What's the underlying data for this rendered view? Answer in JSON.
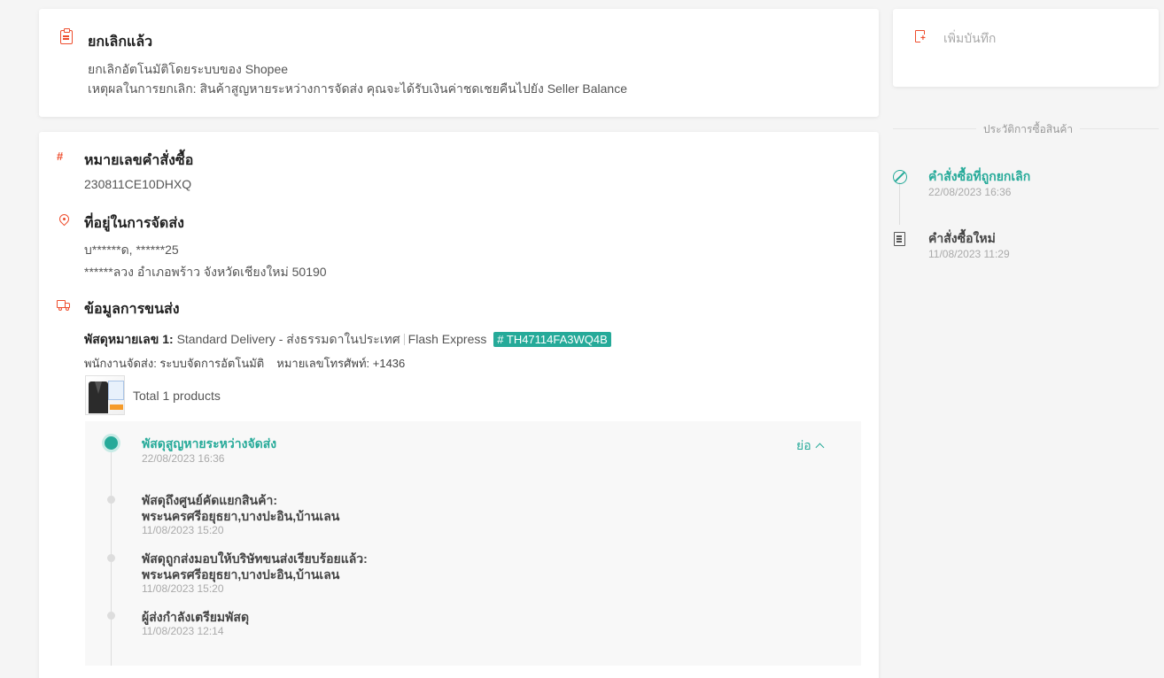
{
  "status": {
    "title": "ยกเลิกแล้ว",
    "line1": "ยกเลิกอัตโนมัติโดยระบบของ Shopee",
    "line2": "เหตุผลในการยกเลิก: สินค้าสูญหายระหว่างการจัดส่ง คุณจะได้รับเงินค่าชดเชยคืนไปยัง Seller Balance"
  },
  "order": {
    "number_title": "หมายเลขคำสั่งซื้อ",
    "number_icon": "#",
    "number": "230811CE10DHXQ",
    "address_title": "ที่อยู่ในการจัดส่ง",
    "address_line1": "บ******ด, ******25",
    "address_line2": "******ลวง อำเภอพร้าว จังหวัดเชียงใหม่ 50190",
    "shipping_title": "ข้อมูลการขนส่ง",
    "parcel_label": "พัสดุหมายเลข 1:",
    "parcel_service": "Standard Delivery - ส่งธรรมดาในประเทศ",
    "parcel_courier": "Flash Express",
    "tracking_number": "# TH47114FA3WQ4B",
    "courier_staff": "พนักงานจัดส่ง:  ระบบจัดการอัตโนมัติ",
    "courier_phone": "หมายเลขโทรศัพท์: +1436",
    "total_products": "Total 1 products"
  },
  "tracking": {
    "collapse_label": "ย่อ",
    "events": [
      {
        "title": "พัสดุสูญหายระหว่างจัดส่ง",
        "time": "22/08/2023 16:36"
      },
      {
        "title": "พัสดุถึงศูนย์คัดแยกสินค้า:",
        "title2": "พระนครศรีอยุธยา,บางปะอิน,บ้านเลน",
        "time": "11/08/2023 15:20"
      },
      {
        "title": "พัสดุถูกส่งมอบให้บริษัทขนส่งเรียบร้อยแล้ว:",
        "title2": "พระนครศรีอยุธยา,บางปะอิน,บ้านเลน",
        "time": "11/08/2023 15:20"
      },
      {
        "title": "ผู้ส่งกำลังเตรียมพัสดุ",
        "time": "11/08/2023 12:14"
      }
    ]
  },
  "note": {
    "label": "เพิ่มบันทึก"
  },
  "history": {
    "label": "ประวัติการซื้อสินค้า",
    "items": [
      {
        "title": "คำสั่งซื้อที่ถูกยกเลิก",
        "time": "22/08/2023 16:36"
      },
      {
        "title": "คำสั่งซื้อใหม่",
        "time": "11/08/2023 11:29"
      }
    ]
  },
  "colors": {
    "accent_orange": "#ee4d2d",
    "accent_teal": "#26aa99"
  }
}
